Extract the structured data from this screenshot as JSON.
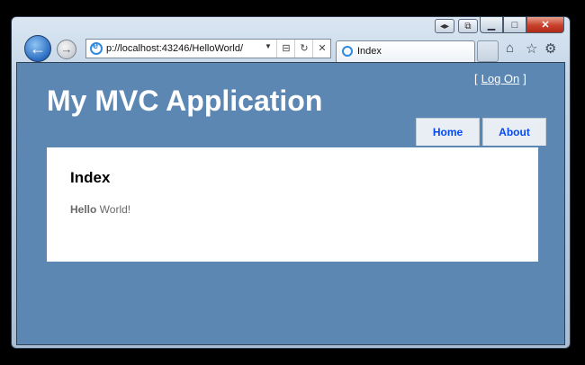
{
  "browser": {
    "address": "p://localhost:43246/HelloWorld/",
    "tab_title": "Index"
  },
  "header": {
    "logon_open": "[",
    "logon_label": "Log On",
    "logon_close": "]",
    "app_title": "My MVC Application",
    "menu": [
      {
        "label": "Home"
      },
      {
        "label": "About"
      }
    ]
  },
  "content": {
    "heading": "Index",
    "message_bold": "Hello",
    "message_rest": " World!"
  },
  "colors": {
    "page_bg": "#5c87b2",
    "menu_text": "#034af3"
  }
}
